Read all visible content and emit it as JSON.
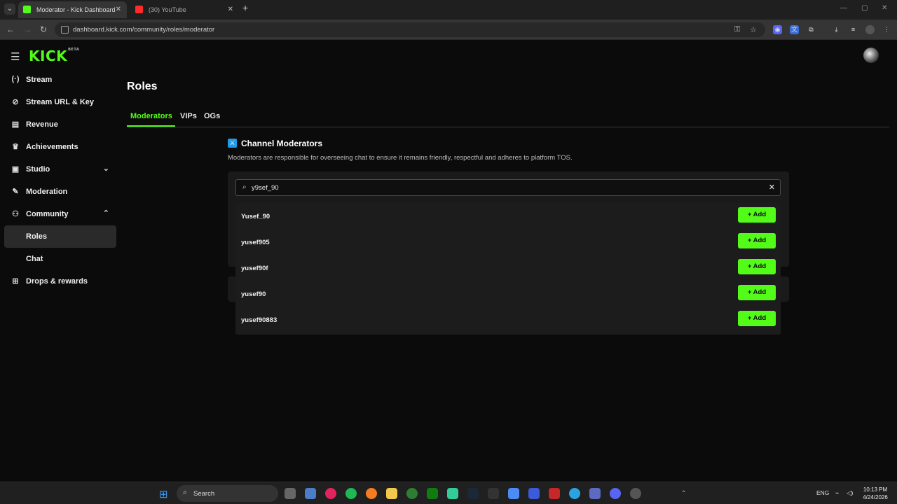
{
  "browser": {
    "tabs": [
      {
        "title": "Moderator - Kick Dashboard",
        "active": true,
        "favicon_color": "#53fc18"
      },
      {
        "title": "(30) YouTube",
        "active": false,
        "favicon_color": "#ff2b2b"
      }
    ],
    "url": "dashboard.kick.com/community/roles/moderator"
  },
  "app": {
    "logo": "KICK",
    "logo_badge": "BETA"
  },
  "sidebar": {
    "items": [
      {
        "label": "Stream",
        "icon": "broadcast-icon",
        "glyph": "(·)"
      },
      {
        "label": "Stream URL & Key",
        "icon": "link-icon",
        "glyph": "⊘"
      },
      {
        "label": "Revenue",
        "icon": "chart-icon",
        "glyph": "▤"
      },
      {
        "label": "Achievements",
        "icon": "trophy-icon",
        "glyph": "♛"
      },
      {
        "label": "Studio",
        "icon": "studio-icon",
        "glyph": "▣",
        "chevron": "⌄"
      },
      {
        "label": "Moderation",
        "icon": "wrench-icon",
        "glyph": "✎"
      },
      {
        "label": "Community",
        "icon": "people-icon",
        "glyph": "⚇",
        "chevron": "⌃"
      },
      {
        "label": "Roles",
        "active": true
      },
      {
        "label": "Chat"
      },
      {
        "label": "Drops & rewards",
        "icon": "gift-icon",
        "glyph": "⊞"
      }
    ]
  },
  "main": {
    "title": "Roles",
    "tabs": [
      "Moderators",
      "VIPs",
      "OGs"
    ],
    "section": {
      "title": "Channel Moderators",
      "description": "Moderators are responsible for overseeing chat to ensure it remains friendly, respectful and adheres to platform TOS."
    },
    "search": {
      "value": "y9sef_90"
    },
    "results": [
      {
        "username": "Yusef_90",
        "action": "+ Add"
      },
      {
        "username": "yusef905",
        "action": "+ Add"
      },
      {
        "username": "yusef90f",
        "action": "+ Add"
      },
      {
        "username": "yusef90",
        "action": "+ Add"
      },
      {
        "username": "yusef90883",
        "action": "+ Add"
      }
    ]
  },
  "taskbar": {
    "search_label": "Search",
    "lang": "ENG",
    "time": "10:13 PM",
    "date": "4/24/2026"
  },
  "colors": {
    "accent": "#53fc18",
    "background": "#0b0b0c"
  }
}
